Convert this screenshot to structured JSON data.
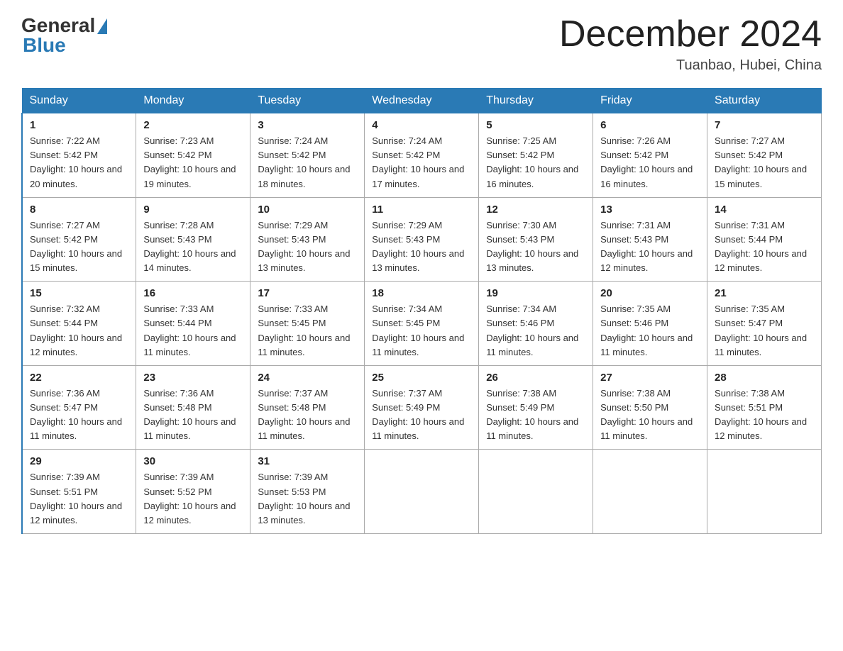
{
  "header": {
    "logo_general": "General",
    "logo_blue": "Blue",
    "title": "December 2024",
    "location": "Tuanbao, Hubei, China"
  },
  "days_of_week": [
    "Sunday",
    "Monday",
    "Tuesday",
    "Wednesday",
    "Thursday",
    "Friday",
    "Saturday"
  ],
  "weeks": [
    [
      {
        "num": "1",
        "sunrise": "7:22 AM",
        "sunset": "5:42 PM",
        "daylight": "10 hours and 20 minutes."
      },
      {
        "num": "2",
        "sunrise": "7:23 AM",
        "sunset": "5:42 PM",
        "daylight": "10 hours and 19 minutes."
      },
      {
        "num": "3",
        "sunrise": "7:24 AM",
        "sunset": "5:42 PM",
        "daylight": "10 hours and 18 minutes."
      },
      {
        "num": "4",
        "sunrise": "7:24 AM",
        "sunset": "5:42 PM",
        "daylight": "10 hours and 17 minutes."
      },
      {
        "num": "5",
        "sunrise": "7:25 AM",
        "sunset": "5:42 PM",
        "daylight": "10 hours and 16 minutes."
      },
      {
        "num": "6",
        "sunrise": "7:26 AM",
        "sunset": "5:42 PM",
        "daylight": "10 hours and 16 minutes."
      },
      {
        "num": "7",
        "sunrise": "7:27 AM",
        "sunset": "5:42 PM",
        "daylight": "10 hours and 15 minutes."
      }
    ],
    [
      {
        "num": "8",
        "sunrise": "7:27 AM",
        "sunset": "5:42 PM",
        "daylight": "10 hours and 15 minutes."
      },
      {
        "num": "9",
        "sunrise": "7:28 AM",
        "sunset": "5:43 PM",
        "daylight": "10 hours and 14 minutes."
      },
      {
        "num": "10",
        "sunrise": "7:29 AM",
        "sunset": "5:43 PM",
        "daylight": "10 hours and 13 minutes."
      },
      {
        "num": "11",
        "sunrise": "7:29 AM",
        "sunset": "5:43 PM",
        "daylight": "10 hours and 13 minutes."
      },
      {
        "num": "12",
        "sunrise": "7:30 AM",
        "sunset": "5:43 PM",
        "daylight": "10 hours and 13 minutes."
      },
      {
        "num": "13",
        "sunrise": "7:31 AM",
        "sunset": "5:43 PM",
        "daylight": "10 hours and 12 minutes."
      },
      {
        "num": "14",
        "sunrise": "7:31 AM",
        "sunset": "5:44 PM",
        "daylight": "10 hours and 12 minutes."
      }
    ],
    [
      {
        "num": "15",
        "sunrise": "7:32 AM",
        "sunset": "5:44 PM",
        "daylight": "10 hours and 12 minutes."
      },
      {
        "num": "16",
        "sunrise": "7:33 AM",
        "sunset": "5:44 PM",
        "daylight": "10 hours and 11 minutes."
      },
      {
        "num": "17",
        "sunrise": "7:33 AM",
        "sunset": "5:45 PM",
        "daylight": "10 hours and 11 minutes."
      },
      {
        "num": "18",
        "sunrise": "7:34 AM",
        "sunset": "5:45 PM",
        "daylight": "10 hours and 11 minutes."
      },
      {
        "num": "19",
        "sunrise": "7:34 AM",
        "sunset": "5:46 PM",
        "daylight": "10 hours and 11 minutes."
      },
      {
        "num": "20",
        "sunrise": "7:35 AM",
        "sunset": "5:46 PM",
        "daylight": "10 hours and 11 minutes."
      },
      {
        "num": "21",
        "sunrise": "7:35 AM",
        "sunset": "5:47 PM",
        "daylight": "10 hours and 11 minutes."
      }
    ],
    [
      {
        "num": "22",
        "sunrise": "7:36 AM",
        "sunset": "5:47 PM",
        "daylight": "10 hours and 11 minutes."
      },
      {
        "num": "23",
        "sunrise": "7:36 AM",
        "sunset": "5:48 PM",
        "daylight": "10 hours and 11 minutes."
      },
      {
        "num": "24",
        "sunrise": "7:37 AM",
        "sunset": "5:48 PM",
        "daylight": "10 hours and 11 minutes."
      },
      {
        "num": "25",
        "sunrise": "7:37 AM",
        "sunset": "5:49 PM",
        "daylight": "10 hours and 11 minutes."
      },
      {
        "num": "26",
        "sunrise": "7:38 AM",
        "sunset": "5:49 PM",
        "daylight": "10 hours and 11 minutes."
      },
      {
        "num": "27",
        "sunrise": "7:38 AM",
        "sunset": "5:50 PM",
        "daylight": "10 hours and 11 minutes."
      },
      {
        "num": "28",
        "sunrise": "7:38 AM",
        "sunset": "5:51 PM",
        "daylight": "10 hours and 12 minutes."
      }
    ],
    [
      {
        "num": "29",
        "sunrise": "7:39 AM",
        "sunset": "5:51 PM",
        "daylight": "10 hours and 12 minutes."
      },
      {
        "num": "30",
        "sunrise": "7:39 AM",
        "sunset": "5:52 PM",
        "daylight": "10 hours and 12 minutes."
      },
      {
        "num": "31",
        "sunrise": "7:39 AM",
        "sunset": "5:53 PM",
        "daylight": "10 hours and 13 minutes."
      },
      null,
      null,
      null,
      null
    ]
  ]
}
